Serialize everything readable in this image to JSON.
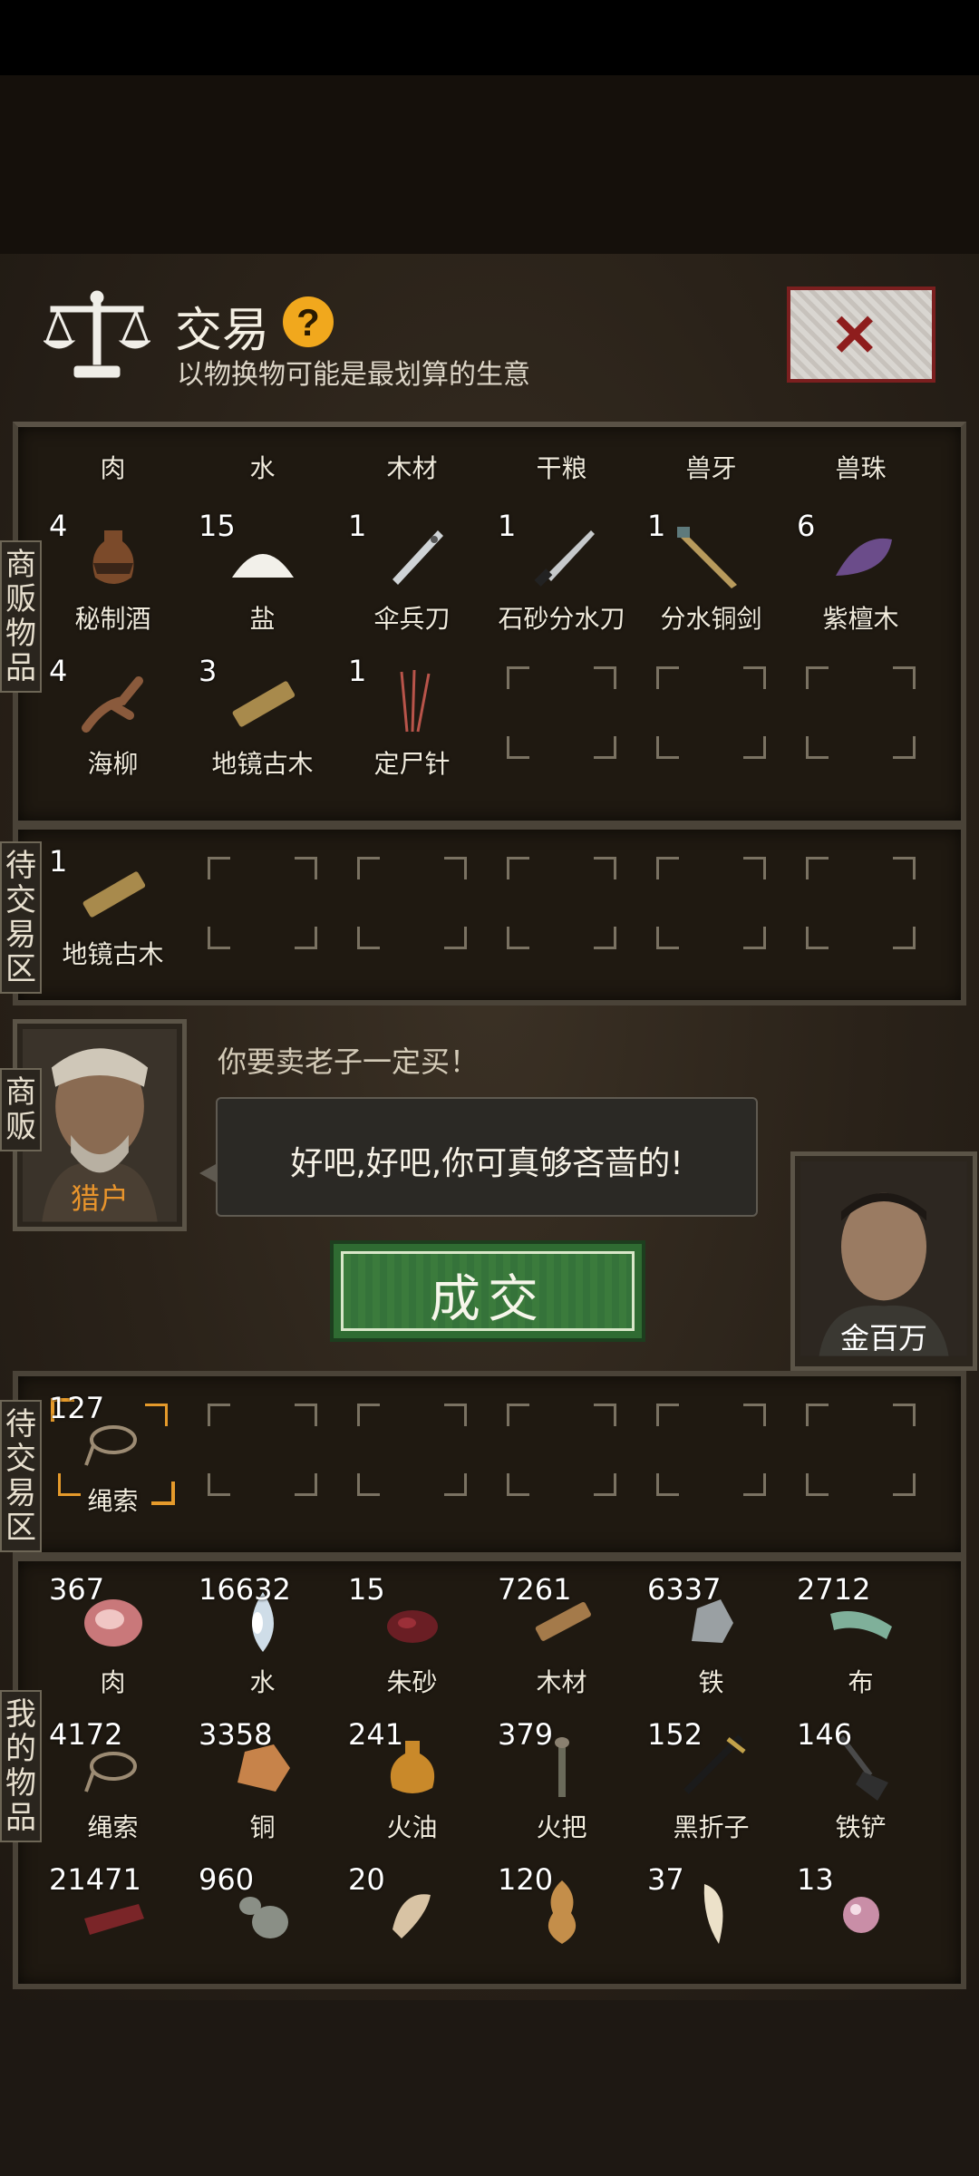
{
  "header": {
    "title": "交易",
    "help": "?",
    "subtitle": "以物换物可能是最划算的生意"
  },
  "labels": {
    "merchant_items": "商贩物品",
    "pending": "待交易区",
    "merchant": "商贩",
    "pending_mine": "待交易区",
    "my_items": "我的物品"
  },
  "merchant_items": [
    {
      "count": "",
      "name": "肉"
    },
    {
      "count": "",
      "name": "水"
    },
    {
      "count": "",
      "name": "木材"
    },
    {
      "count": "",
      "name": "干粮"
    },
    {
      "count": "",
      "name": "兽牙"
    },
    {
      "count": "",
      "name": "兽珠"
    },
    {
      "count": "4",
      "name": "秘制酒"
    },
    {
      "count": "15",
      "name": "盐"
    },
    {
      "count": "1",
      "name": "伞兵刀"
    },
    {
      "count": "1",
      "name": "石砂分水刀"
    },
    {
      "count": "1",
      "name": "分水铜剑"
    },
    {
      "count": "6",
      "name": "紫檀木"
    },
    {
      "count": "4",
      "name": "海柳"
    },
    {
      "count": "3",
      "name": "地镜古木"
    },
    {
      "count": "1",
      "name": "定尸针"
    }
  ],
  "pending_items": [
    {
      "count": "1",
      "name": "地镜古木"
    }
  ],
  "merchant": {
    "name": "猎户",
    "quote": "你要卖老子一定买！",
    "reply": "好吧,好吧,你可真够吝啬的!"
  },
  "deal_label": "成交",
  "player": {
    "name": "金百万",
    "stars": "★★"
  },
  "pending_mine": [
    {
      "count": "127",
      "name": "绳索"
    }
  ],
  "my_items": [
    {
      "count": "367",
      "name": "肉"
    },
    {
      "count": "16632",
      "name": "水"
    },
    {
      "count": "15",
      "name": "朱砂"
    },
    {
      "count": "7261",
      "name": "木材"
    },
    {
      "count": "6337",
      "name": "铁"
    },
    {
      "count": "2712",
      "name": "布"
    },
    {
      "count": "4172",
      "name": "绳索"
    },
    {
      "count": "3358",
      "name": "铜"
    },
    {
      "count": "241",
      "name": "火油"
    },
    {
      "count": "379",
      "name": "火把"
    },
    {
      "count": "152",
      "name": "黑折子"
    },
    {
      "count": "146",
      "name": "铁铲"
    },
    {
      "count": "21471",
      "name": ""
    },
    {
      "count": "960",
      "name": ""
    },
    {
      "count": "20",
      "name": ""
    },
    {
      "count": "120",
      "name": ""
    },
    {
      "count": "37",
      "name": ""
    },
    {
      "count": "13",
      "name": ""
    }
  ],
  "colors": {
    "accent_orange": "#e8942c",
    "deal_green": "#2f6b32",
    "close_red": "#8e1d1d",
    "help_yellow": "#f1a81d"
  },
  "icons": {
    "merchant_items": [
      "meat-icon",
      "water-icon",
      "wood-icon",
      "ration-icon",
      "beast-tooth-icon",
      "beast-pearl-icon",
      "wine-jar-icon",
      "salt-icon",
      "paratrooper-knife-icon",
      "cinnabar-knife-icon",
      "bronze-sword-icon",
      "rosewood-icon",
      "sea-willow-icon",
      "ancient-wood-icon",
      "corpse-needle-icon"
    ],
    "my_items": [
      "meat-icon",
      "water-drop-icon",
      "cinnabar-icon",
      "wood-icon",
      "iron-ore-icon",
      "cloth-icon",
      "rope-icon",
      "copper-ore-icon",
      "fire-oil-icon",
      "torch-icon",
      "fire-starter-icon",
      "shovel-icon",
      "dried-meat-icon",
      "gourd-icon",
      "bone-icon",
      "tiger-skin-icon",
      "tooth-icon",
      "pearl-icon"
    ]
  }
}
